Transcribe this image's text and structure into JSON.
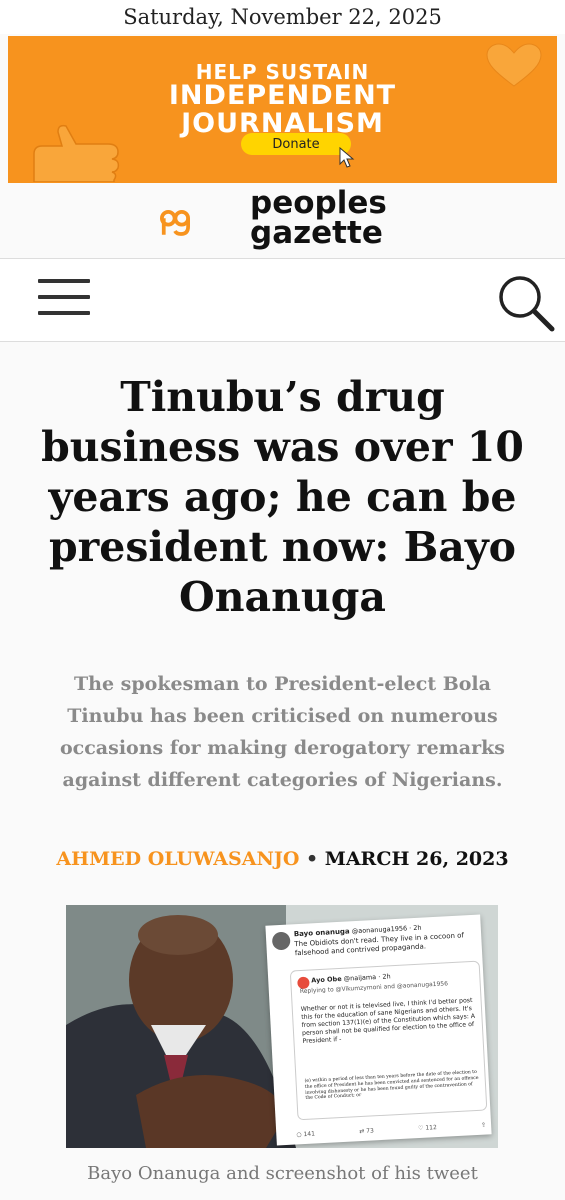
{
  "date": "Saturday, November 22, 2025",
  "banner": {
    "line1": "HELP SUSTAIN",
    "line2": "INDEPENDENT",
    "line3": "JOURNALISM",
    "donate_label": "Donate"
  },
  "logo": {
    "line1": "peoples",
    "line2": "gazette"
  },
  "article": {
    "headline": "Tinubu’s drug business was over 10 years ago; he can be president now: Bayo Onanuga",
    "summary": "The spokesman to President-elect Bola Tinubu has been criticised on numerous occasions for making derogatory remarks against different categories of Nigerians.",
    "author": "AHMED OLUWASANJO",
    "separator": "•",
    "published": "MARCH 26, 2023",
    "caption": "Bayo Onanuga and screenshot of his tweet"
  },
  "tweet": {
    "name": "Bayo onanuga",
    "handle": "@aonanuga1956 · 2h",
    "text": "The Obidiots don't read. They live in a cocoon of falsehood and contrived propaganda.",
    "quote_name": "Ayo Obe",
    "quote_handle": "@naijama · 2h",
    "quote_reply": "Replying to @Vikumzymoni and @aonanuga1956",
    "quote_body": "Whether or not it is televised live, I think I'd better post this for the education of sane Nigerians and others. It's from section 137(1)(e) of the Constitution which says: A person shall not be qualified for election to the office of President if -",
    "quote_body2": "(e) within a period of less than ten years before the date of the election to the office of President he has been convicted and sentenced for an offence involving dishonesty or he has been found guilty of the contravention of the Code of Conduct; or",
    "replies": "141",
    "retweets": "73",
    "likes": "112"
  },
  "colors": {
    "accent": "#f7931e",
    "summary_text": "#8a8a8a"
  }
}
